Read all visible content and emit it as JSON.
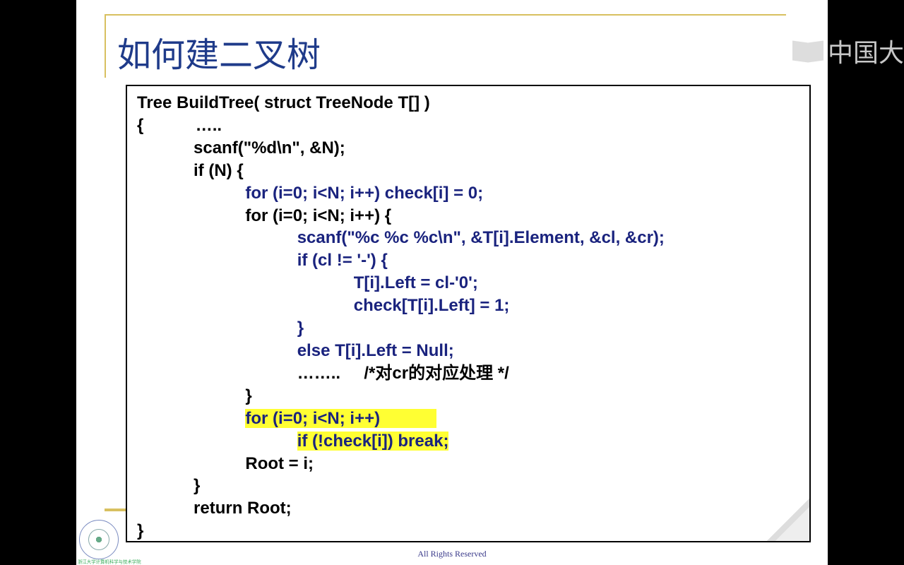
{
  "title": "如何建二叉树",
  "watermark": "中国大",
  "footer": "All Rights Reserved",
  "uni_caption": "浙江大学计算机科学与技术学院",
  "code": {
    "l1": "Tree BuildTree( struct TreeNode T[] )",
    "l2": "{           …..",
    "l3": "            scanf(\"%d\\n\", &N);",
    "l4": "            if (N) {",
    "l5": "                       for (i=0; i<N; i++) check[i] = 0;",
    "l6": "                       for (i=0; i<N; i++) {",
    "l7": "                                  scanf(\"%c %c %c\\n\", &T[i].Element, &cl, &cr);",
    "l8": "                                  if (cl != '-') {",
    "l9": "                                              T[i].Left = cl-'0';",
    "l10": "                                              check[T[i].Left] = 1;",
    "l11": "                                  }",
    "l12": "                                  else T[i].Left = Null;",
    "l13a": "                                  ……..     ",
    "l13b": "/*对cr的对应处理 */",
    "l14": "                       }",
    "l15a": "                       ",
    "l15b": "for (i=0; i<N; i++)            ",
    "l16a": "                                  ",
    "l16b": "if (!check[i]) break;",
    "l17": "                       Root = i;",
    "l18": "            }",
    "l19": "            return Root;",
    "l20": "}"
  }
}
